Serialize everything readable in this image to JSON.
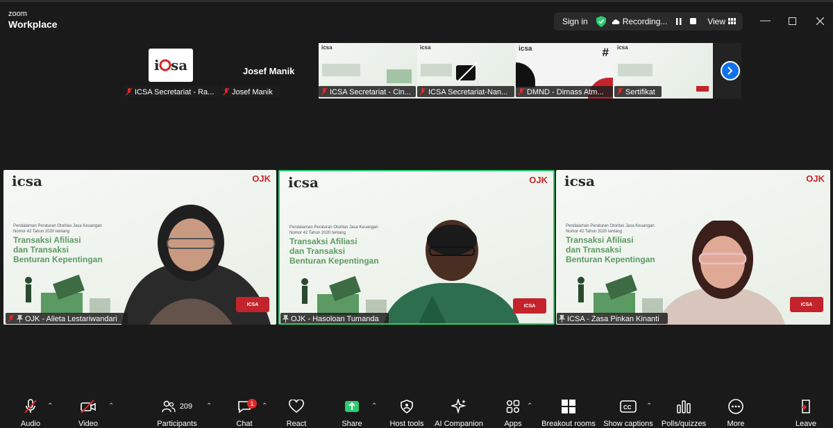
{
  "app": {
    "brand_line1": "zoom",
    "brand_line2": "Workplace"
  },
  "titlebar": {
    "sign_in": "Sign in",
    "recording": "Recording...",
    "view": "View"
  },
  "thumbnails": [
    {
      "name": "ICSA Secretariat - Ra..."
    },
    {
      "display_name": "Josef Manik",
      "name": "Josef Manik"
    },
    {
      "name": "ICSA Secretariat - Cin..."
    },
    {
      "name": "ICSA Secretariat-Nan..."
    },
    {
      "name": "DMND - Dimass Atm..."
    },
    {
      "name": "Sertifikat"
    }
  ],
  "slide": {
    "intro": "Pendalaman Peraturan Otoritas Jasa Keuangan Nomor 42 Tahun 2020 tentang",
    "title_line1": "Transaksi Afiliasi",
    "title_line2": "dan Transaksi",
    "title_line3": "Benturan Kepentingan",
    "icsa_logo": "icsa",
    "ojk_logo": "OJK",
    "badge": "ICSA"
  },
  "videos": [
    {
      "name": "OJK - Alieta Lestariwandari"
    },
    {
      "name": "OJK - Hasoloan Tumanda"
    },
    {
      "name": "ICSA - Zasa Pinkan Kinanti"
    }
  ],
  "toolbar": {
    "audio": "Audio",
    "video": "Video",
    "participants": "Participants",
    "participants_count": "209",
    "chat": "Chat",
    "chat_badge": "1",
    "react": "React",
    "share": "Share",
    "host_tools": "Host tools",
    "ai_companion": "AI Companion",
    "apps": "Apps",
    "breakout_rooms": "Breakout rooms",
    "show_captions": "Show captions",
    "polls": "Polls/quizzes",
    "more": "More",
    "leave": "Leave"
  },
  "colors": {
    "accent_blue": "#0e72ed",
    "active_border": "#2bcc71",
    "brand_red": "#c4232b",
    "slide_green": "#5b9a62"
  }
}
